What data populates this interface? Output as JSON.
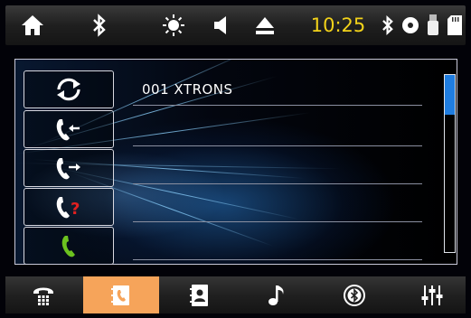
{
  "status_bar": {
    "time": "10:25",
    "icons": [
      "home-icon",
      "bluetooth-icon",
      "brightness-icon",
      "volume-icon",
      "eject-icon",
      "bluetooth-icon",
      "disc-icon",
      "usb-icon",
      "sd-card-icon"
    ]
  },
  "phonebook": {
    "entries": [
      {
        "label": "001  XTRONS"
      }
    ],
    "side_buttons": [
      "sync-icon",
      "incoming-call-icon",
      "outgoing-call-icon",
      "missed-call-icon",
      "dial-icon"
    ],
    "scroll_position": 0.0
  },
  "bottom_nav": {
    "items": [
      "dialpad-icon",
      "phonebook-icon",
      "contacts-icon",
      "music-icon",
      "bluetooth-settings-icon",
      "equalizer-icon"
    ],
    "active_index": 1
  },
  "colors": {
    "clock": "#f2d21a",
    "active_tab": "#f6a45a",
    "scroll_thumb": "#1f7de0",
    "missed": "#e02020",
    "dial": "#6cc21f"
  }
}
